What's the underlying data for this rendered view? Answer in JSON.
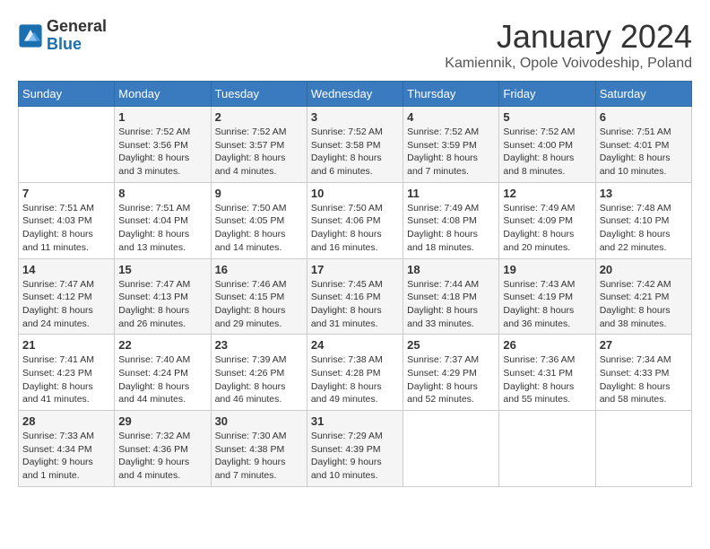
{
  "header": {
    "logo_general": "General",
    "logo_blue": "Blue",
    "month_title": "January 2024",
    "subtitle": "Kamiennik, Opole Voivodeship, Poland"
  },
  "days_of_week": [
    "Sunday",
    "Monday",
    "Tuesday",
    "Wednesday",
    "Thursday",
    "Friday",
    "Saturday"
  ],
  "weeks": [
    [
      {
        "day": "",
        "info": ""
      },
      {
        "day": "1",
        "info": "Sunrise: 7:52 AM\nSunset: 3:56 PM\nDaylight: 8 hours\nand 3 minutes."
      },
      {
        "day": "2",
        "info": "Sunrise: 7:52 AM\nSunset: 3:57 PM\nDaylight: 8 hours\nand 4 minutes."
      },
      {
        "day": "3",
        "info": "Sunrise: 7:52 AM\nSunset: 3:58 PM\nDaylight: 8 hours\nand 6 minutes."
      },
      {
        "day": "4",
        "info": "Sunrise: 7:52 AM\nSunset: 3:59 PM\nDaylight: 8 hours\nand 7 minutes."
      },
      {
        "day": "5",
        "info": "Sunrise: 7:52 AM\nSunset: 4:00 PM\nDaylight: 8 hours\nand 8 minutes."
      },
      {
        "day": "6",
        "info": "Sunrise: 7:51 AM\nSunset: 4:01 PM\nDaylight: 8 hours\nand 10 minutes."
      }
    ],
    [
      {
        "day": "7",
        "info": "Sunrise: 7:51 AM\nSunset: 4:03 PM\nDaylight: 8 hours\nand 11 minutes."
      },
      {
        "day": "8",
        "info": "Sunrise: 7:51 AM\nSunset: 4:04 PM\nDaylight: 8 hours\nand 13 minutes."
      },
      {
        "day": "9",
        "info": "Sunrise: 7:50 AM\nSunset: 4:05 PM\nDaylight: 8 hours\nand 14 minutes."
      },
      {
        "day": "10",
        "info": "Sunrise: 7:50 AM\nSunset: 4:06 PM\nDaylight: 8 hours\nand 16 minutes."
      },
      {
        "day": "11",
        "info": "Sunrise: 7:49 AM\nSunset: 4:08 PM\nDaylight: 8 hours\nand 18 minutes."
      },
      {
        "day": "12",
        "info": "Sunrise: 7:49 AM\nSunset: 4:09 PM\nDaylight: 8 hours\nand 20 minutes."
      },
      {
        "day": "13",
        "info": "Sunrise: 7:48 AM\nSunset: 4:10 PM\nDaylight: 8 hours\nand 22 minutes."
      }
    ],
    [
      {
        "day": "14",
        "info": "Sunrise: 7:47 AM\nSunset: 4:12 PM\nDaylight: 8 hours\nand 24 minutes."
      },
      {
        "day": "15",
        "info": "Sunrise: 7:47 AM\nSunset: 4:13 PM\nDaylight: 8 hours\nand 26 minutes."
      },
      {
        "day": "16",
        "info": "Sunrise: 7:46 AM\nSunset: 4:15 PM\nDaylight: 8 hours\nand 29 minutes."
      },
      {
        "day": "17",
        "info": "Sunrise: 7:45 AM\nSunset: 4:16 PM\nDaylight: 8 hours\nand 31 minutes."
      },
      {
        "day": "18",
        "info": "Sunrise: 7:44 AM\nSunset: 4:18 PM\nDaylight: 8 hours\nand 33 minutes."
      },
      {
        "day": "19",
        "info": "Sunrise: 7:43 AM\nSunset: 4:19 PM\nDaylight: 8 hours\nand 36 minutes."
      },
      {
        "day": "20",
        "info": "Sunrise: 7:42 AM\nSunset: 4:21 PM\nDaylight: 8 hours\nand 38 minutes."
      }
    ],
    [
      {
        "day": "21",
        "info": "Sunrise: 7:41 AM\nSunset: 4:23 PM\nDaylight: 8 hours\nand 41 minutes."
      },
      {
        "day": "22",
        "info": "Sunrise: 7:40 AM\nSunset: 4:24 PM\nDaylight: 8 hours\nand 44 minutes."
      },
      {
        "day": "23",
        "info": "Sunrise: 7:39 AM\nSunset: 4:26 PM\nDaylight: 8 hours\nand 46 minutes."
      },
      {
        "day": "24",
        "info": "Sunrise: 7:38 AM\nSunset: 4:28 PM\nDaylight: 8 hours\nand 49 minutes."
      },
      {
        "day": "25",
        "info": "Sunrise: 7:37 AM\nSunset: 4:29 PM\nDaylight: 8 hours\nand 52 minutes."
      },
      {
        "day": "26",
        "info": "Sunrise: 7:36 AM\nSunset: 4:31 PM\nDaylight: 8 hours\nand 55 minutes."
      },
      {
        "day": "27",
        "info": "Sunrise: 7:34 AM\nSunset: 4:33 PM\nDaylight: 8 hours\nand 58 minutes."
      }
    ],
    [
      {
        "day": "28",
        "info": "Sunrise: 7:33 AM\nSunset: 4:34 PM\nDaylight: 9 hours\nand 1 minute."
      },
      {
        "day": "29",
        "info": "Sunrise: 7:32 AM\nSunset: 4:36 PM\nDaylight: 9 hours\nand 4 minutes."
      },
      {
        "day": "30",
        "info": "Sunrise: 7:30 AM\nSunset: 4:38 PM\nDaylight: 9 hours\nand 7 minutes."
      },
      {
        "day": "31",
        "info": "Sunrise: 7:29 AM\nSunset: 4:39 PM\nDaylight: 9 hours\nand 10 minutes."
      },
      {
        "day": "",
        "info": ""
      },
      {
        "day": "",
        "info": ""
      },
      {
        "day": "",
        "info": ""
      }
    ]
  ]
}
